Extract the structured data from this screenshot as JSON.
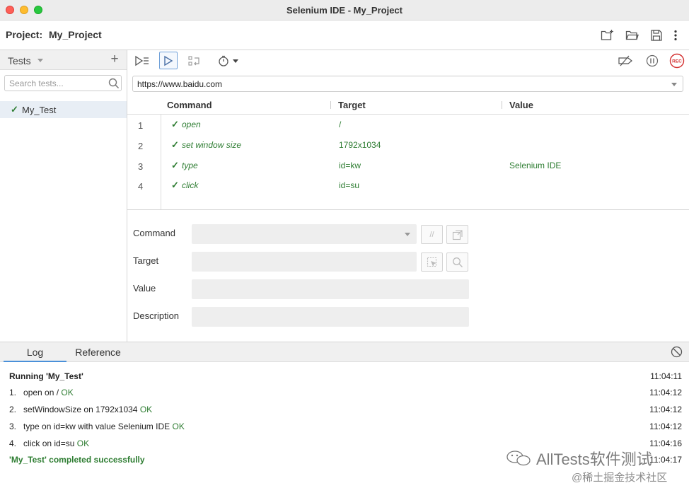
{
  "window": {
    "title": "Selenium IDE - My_Project"
  },
  "project": {
    "label": "Project:",
    "name": "My_Project"
  },
  "sidebar": {
    "header": "Tests",
    "search_placeholder": "Search tests...",
    "tests": [
      {
        "name": "My_Test",
        "status": "passed"
      }
    ]
  },
  "url": {
    "value": "https://www.baidu.com"
  },
  "table": {
    "headers": {
      "command": "Command",
      "target": "Target",
      "value": "Value"
    },
    "rows": [
      {
        "index": "1",
        "command": "open",
        "target": "/",
        "value": ""
      },
      {
        "index": "2",
        "command": "set window size",
        "target": "1792x1034",
        "value": ""
      },
      {
        "index": "3",
        "command": "type",
        "target": "id=kw",
        "value": "Selenium IDE"
      },
      {
        "index": "4",
        "command": "click",
        "target": "id=su",
        "value": ""
      }
    ]
  },
  "editor": {
    "command_label": "Command",
    "target_label": "Target",
    "value_label": "Value",
    "description_label": "Description",
    "comment_button": "//"
  },
  "bottom": {
    "tabs": [
      "Log",
      "Reference"
    ],
    "log": {
      "running": {
        "text": "Running 'My_Test'",
        "time": "11:04:11"
      },
      "entries": [
        {
          "num": "1.",
          "text": "open on /",
          "status": "OK",
          "time": "11:04:12"
        },
        {
          "num": "2.",
          "text": "setWindowSize on 1792x1034",
          "status": "OK",
          "time": "11:04:12"
        },
        {
          "num": "3.",
          "text": "type on id=kw with value Selenium IDE",
          "status": "OK",
          "time": "11:04:12"
        },
        {
          "num": "4.",
          "text": "click on id=su",
          "status": "OK",
          "time": "11:04:16"
        }
      ],
      "completed": {
        "text": "'My_Test' completed successfully",
        "time": "11:04:17"
      }
    }
  },
  "watermark": {
    "main": "AllTests软件测试",
    "sub": "@稀土掘金技术社区"
  },
  "colors": {
    "pass_green": "#2e7d32",
    "record_red": "#d32f2f",
    "active_blue": "#4a90d9"
  }
}
